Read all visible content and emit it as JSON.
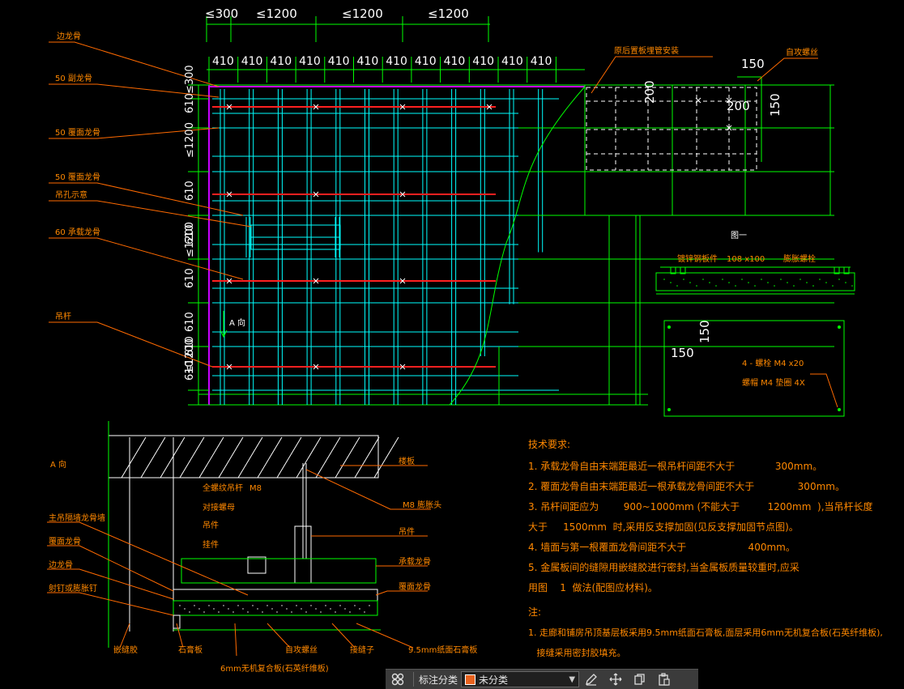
{
  "colors": {
    "background": "#000000",
    "grid": "#00ffff",
    "line": "#00ff00",
    "dim": "#00ff00",
    "label": "#ff8800",
    "red": "#ff2020",
    "magenta": "#c800ff",
    "white": "#ffffff",
    "leader": "#ff6a00"
  },
  "plan": {
    "top_dims": [
      "≤300",
      "≤1200",
      "≤1200",
      "≤1200"
    ],
    "bay_dims": [
      "410",
      "410",
      "410",
      "410",
      "410",
      "410",
      "410",
      "410",
      "410",
      "410",
      "410",
      "410"
    ],
    "left_dims": [
      "≤300",
      "610",
      "≤1200",
      "610",
      "610",
      "≤1200",
      "610",
      "610",
      "≤1200",
      "610",
      "610"
    ],
    "labels": [
      "边龙骨",
      "50 副龙骨",
      "50 覆面龙骨",
      "50 覆面龙骨",
      "吊孔示意",
      "60 承载龙骨",
      "吊杆"
    ],
    "arrow_label": "A 向",
    "detail_title": "原后置板埋管安装",
    "corner_label": "自攻螺丝",
    "detail_dims": [
      "150",
      "200",
      "200",
      "150"
    ]
  },
  "fig1": {
    "title": "图一",
    "labels": [
      "镀锌钢板件",
      "108 x100",
      "膨胀螺栓"
    ],
    "dims": [
      "150",
      "150"
    ],
    "notes": [
      "4 - 螺栓  M4 x20",
      "螺帽  M4 垫圈  4X"
    ]
  },
  "section": {
    "title": "A 向",
    "left_labels": [
      "主吊隔墙龙骨墙",
      "覆面龙骨",
      "边龙骨",
      "射钉或膨胀钉"
    ],
    "mid_labels": [
      "全螺纹吊杆",
      "对接螺母",
      "吊件",
      "挂件"
    ],
    "rod_spec": "M8",
    "right_labels": [
      "楼板",
      "M8 膨胀头",
      "吊件",
      "承载龙骨",
      "覆面龙骨"
    ],
    "bottom_labels": [
      "嵌缝胶",
      "石膏板",
      "6mm无机复合板(石英纤维板)",
      "自攻螺丝",
      "接缝子",
      "9.5mm纸面石膏板"
    ]
  },
  "notes": {
    "title": "技术要求:",
    "lines": [
      "1. 承载龙骨自由末端距最近一根吊杆间距不大于             300mm。",
      "2. 覆面龙骨自由末端距最近一根承载龙骨间距不大于              300mm。",
      "3. 吊杆间距应为        900~1000mm (不能大于         1200mm  ),当吊杆长度",
      "大于     1500mm  时,采用反支撑加固(见反支撑加固节点图)。",
      "4. 墙面与第一根覆面龙骨间距不大于                    400mm。",
      "5. 金属板间的缝隙用嵌缝胶进行密封,当金属板质量较重时,应采",
      "用图    1  做法(配图应材料)。"
    ],
    "note_title": "注:",
    "note_lines": [
      "1. 走廊和铺房吊顶基层板采用9.5mm纸面石膏板,面层采用6mm无机复合板(石英纤维板),",
      "   接缝采用密封胶填充。"
    ]
  },
  "toolbar": {
    "grid_icon": "grid-icon",
    "label": "标注分类",
    "select_value": "未分类",
    "swatch": "#e8621e",
    "icons": [
      "edit-icon",
      "move-icon",
      "copy-icon",
      "paste-icon"
    ]
  }
}
